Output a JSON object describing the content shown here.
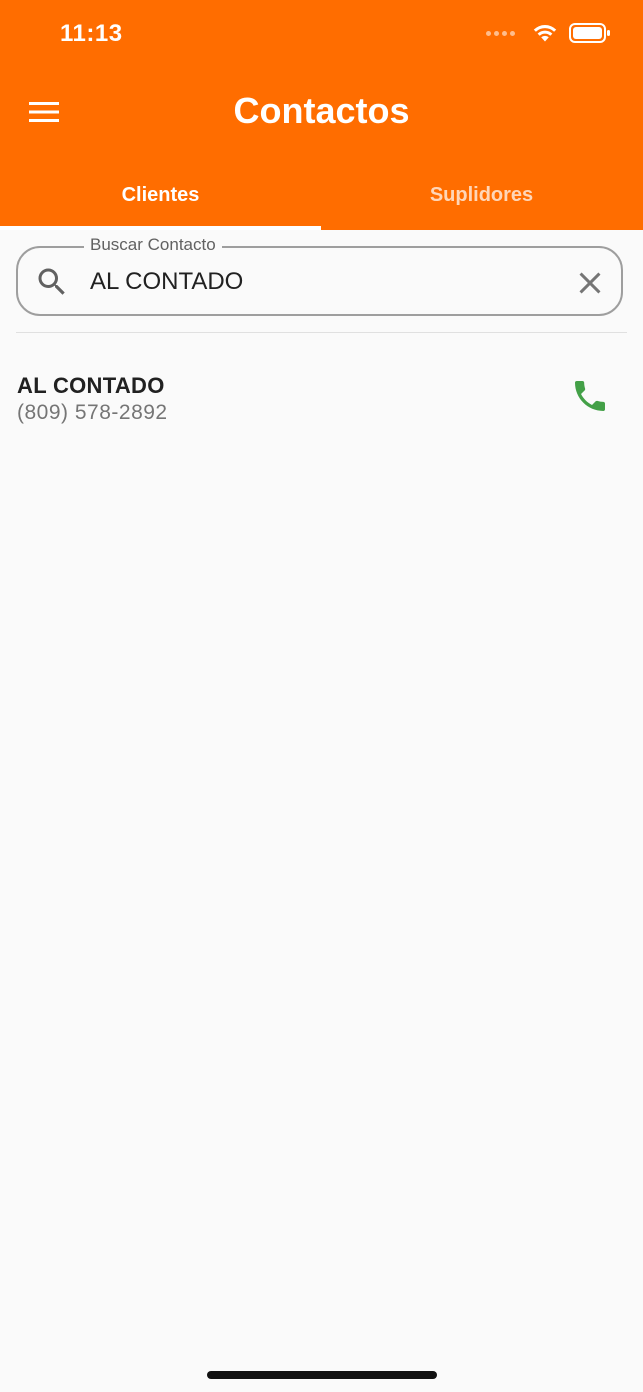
{
  "status_bar": {
    "time": "11:13"
  },
  "app_bar": {
    "title": "Contactos",
    "menu_icon": "hamburger-menu-icon",
    "color": "#ff6d00"
  },
  "tabs": [
    {
      "label": "Clientes",
      "selected": true
    },
    {
      "label": "Suplidores",
      "selected": false
    }
  ],
  "search": {
    "label": "Buscar Contacto",
    "value": "AL CONTADO",
    "icon": "search-icon",
    "clear_icon": "close-icon"
  },
  "contacts": [
    {
      "name": "AL CONTADO",
      "phone": "(809) 578-2892",
      "action_icon": "phone-icon",
      "action_color": "#43a047"
    }
  ]
}
